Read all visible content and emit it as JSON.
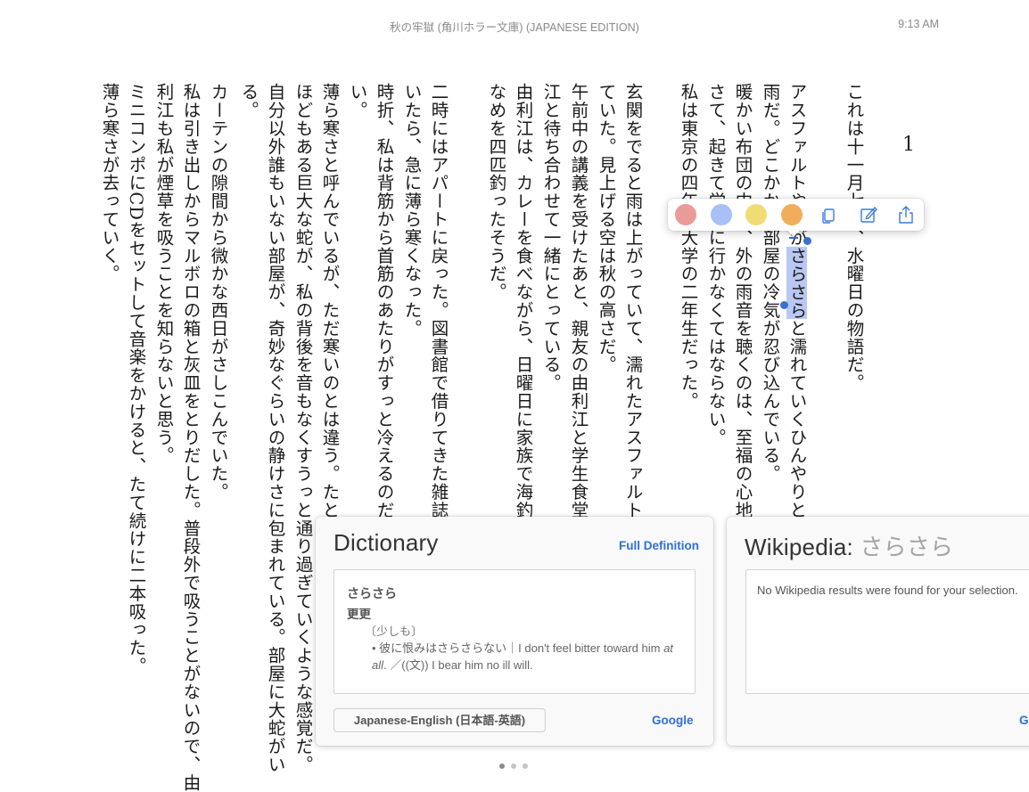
{
  "header": {
    "book_title": "秋の牢獄 (角川ホラー文庫) (JAPANESE EDITION)",
    "time": "9:13 AM"
  },
  "page_number": "1",
  "text": {
    "col1": "これは十一月七日、水曜日の物語だ。",
    "col2_a": "アスファルトや葉が",
    "col2_sel": "さらさら",
    "col2_b": "と濡れていくひんやりとした音",
    "col3": "雨だ。どこかから部屋の冷気が忍び込んでいる。",
    "col4": "暖かい布団の中で、外の雨音を聴くのは、至福の心地だった。",
    "col5": "さて、起きて学校に行かなくてはならない。",
    "col6": "私は東京の四年制大学の二年生だった。",
    "col7": "玄関をでると雨は上がっていて、濡れたアスファルトの路面",
    "col8": "ていた。見上げる空は秋の高さだ。",
    "col9": "午前中の講義を受けたあと、親友の由利江と学生食堂で昼食",
    "col10": "江と待ち合わせて一緒にとっている。",
    "col11": "由利江は、カレーを食べながら、日曜日に家族で海釣りに行",
    "col12": "なめを四匹釣ったそうだ。",
    "col13": "二時にはアパートに戻った。図書館で借りてきた雑誌を読ん",
    "col14": "いたら、急に薄ら寒くなった。",
    "col15": "時折、私は背筋から首筋のあたりがすっと冷えるのだ。これ",
    "col16": "い。",
    "col17": "薄ら寒さと呼んでいるが、ただ寒いのとは違う。たとえてい",
    "col18": "ほどもある巨大な蛇が、私の背後を音もなくすうっと通り過ぎていくような感覚だ。",
    "col19": "自分以外誰もいない部屋が、奇妙なぐらいの静けさに包まれている。部屋に大蛇がい",
    "col20": "る。",
    "col21": "カーテンの隙間から微かな西日がさしこんでいた。",
    "col22": "私は引き出しからマルボロの箱と灰皿をとりだした。普段外で吸うことがないので、由",
    "col23": "利江も私が煙草を吸うことを知らないと思う。",
    "col24": "ミニコンポにCDをセットして音楽をかけると、たて続けに二本吸った。",
    "col25": "薄ら寒さが去っていく。"
  },
  "toolbar": {
    "colors": [
      "#eb9a9a",
      "#a9c0f6",
      "#f0dc72",
      "#f0ae5d"
    ],
    "icons": [
      "copy-icon",
      "note-icon",
      "share-icon"
    ]
  },
  "dictionary": {
    "title": "Dictionary",
    "full_definition": "Full Definition",
    "headword": "さらさら",
    "kanji": "更更",
    "sense": "〔少しも〕",
    "example_jp": "• 彼に恨みはさらさらない｜I don't feel bitter toward him ",
    "example_at": "at all",
    "example_rest": ". ／((文)) I bear him no ill will.",
    "dictionary_name": "Japanese-English (日本語-英語)",
    "google": "Google"
  },
  "wikipedia": {
    "title": "Wikipedia:",
    "query": "さらさら",
    "message": "No Wikipedia results were found for your selection.",
    "link_fragment": "G"
  },
  "accent": "#2f6fd6"
}
